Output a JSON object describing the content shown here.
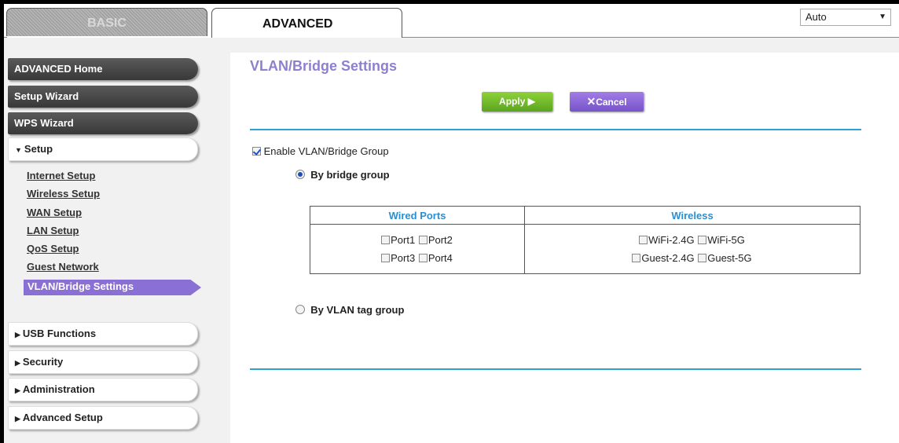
{
  "tabs": {
    "basic": "BASIC",
    "advanced": "ADVANCED"
  },
  "language": {
    "selected": "Auto"
  },
  "nav": {
    "advanced_home": "ADVANCED Home",
    "setup_wizard": "Setup Wizard",
    "wps_wizard": "WPS Wizard",
    "setup": "Setup",
    "setup_items": [
      "Internet Setup",
      "Wireless Setup",
      "WAN Setup",
      "LAN Setup",
      "QoS Setup",
      "Guest Network"
    ],
    "active_item": "VLAN/Bridge Settings",
    "usb_functions": "USB Functions",
    "security": "Security",
    "administration": "Administration",
    "advanced_setup": "Advanced Setup"
  },
  "main": {
    "title": "VLAN/Bridge Settings",
    "apply_label": "Apply ▶",
    "cancel_label": "Cancel",
    "enable_label": "Enable VLAN/Bridge Group",
    "enable_checked": true,
    "by_bridge_label": "By bridge group",
    "by_vlan_label": "By VLAN tag group",
    "table": {
      "wired_header": "Wired Ports",
      "wireless_header": "Wireless",
      "wired": [
        "Port1",
        "Port2",
        "Port3",
        "Port4"
      ],
      "wireless": [
        "WiFi-2.4G",
        "WiFi-5G",
        "Guest-2.4G",
        "Guest-5G"
      ]
    }
  },
  "colors": {
    "title": "#8f7fd0",
    "active_nav": "#8a6fd4",
    "apply": "#6fbf2a",
    "cancel": "#8a66d8",
    "rule": "#2fa0d0",
    "table_header": "#2a8fd0"
  }
}
